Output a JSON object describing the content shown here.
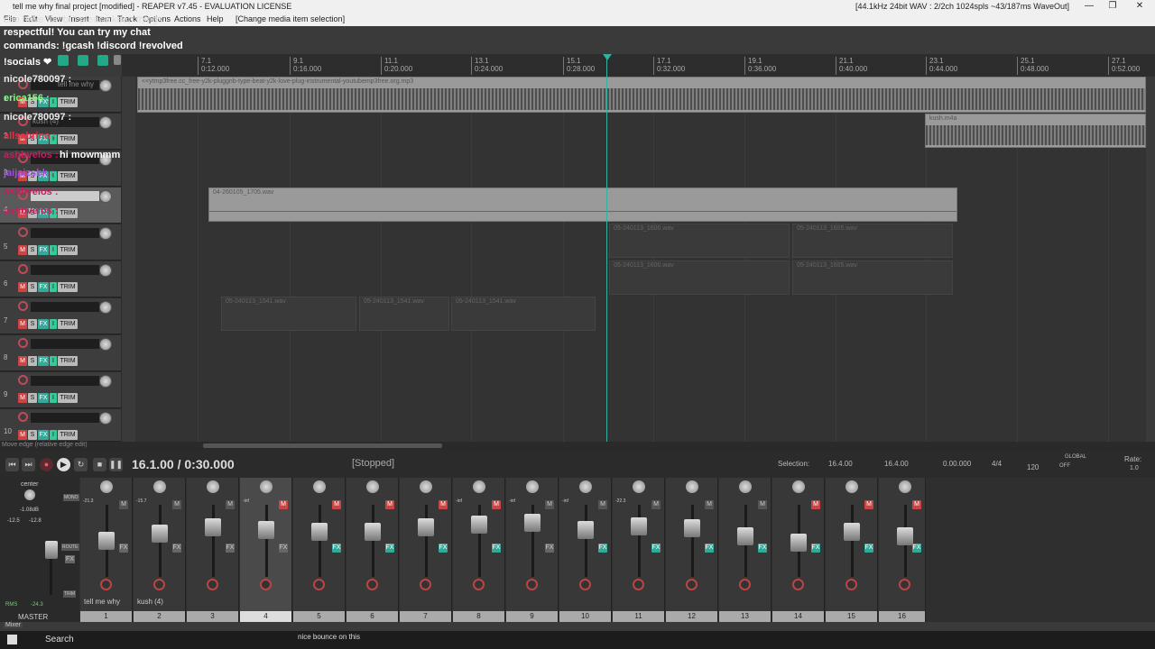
{
  "window": {
    "title": "tell me why final project [modified] - REAPER v7.45 - EVALUATION LICENSE",
    "audio_info": "[44.1kHz 24bit WAV : 2/2ch 1024spls ~43/187ms WaveOut]",
    "minimize": "—",
    "maximize": "❐",
    "close": "✕"
  },
  "menu": {
    "items": [
      "File",
      "Edit",
      "View",
      "Insert",
      "Item",
      "Track",
      "Options",
      "Actions",
      "Help"
    ],
    "change_media": "[Change media item selection]"
  },
  "chat_overlay": {
    "lines": [
      "can have fun but please keep things",
      "respectful! You can try my chat",
      "commands: !gcash !discord !revolved",
      "!socials ❤"
    ],
    "tcp_messages": [
      {
        "user": "nicole780097 :",
        "text": "",
        "color": "#e8e8e8"
      },
      {
        "user": "erica156 :",
        "text": "",
        "color": "#7cfc7c"
      },
      {
        "user": "nicole780097 :",
        "text": "",
        "color": "#e8e8e8"
      },
      {
        "user": "allsabrina :",
        "text": "",
        "color": "#e0304a"
      },
      {
        "user": "ashbvelos :",
        "text": "hi mowmmm",
        "color": "#c02060"
      },
      {
        "user": "jaijaizsbk :",
        "text": "",
        "color": "#a050e0"
      },
      {
        "user": "ashbvelos :",
        "text": "",
        "color": "#c02060"
      },
      {
        "user": "ashbvelos :",
        "text": "",
        "color": "#c02060"
      }
    ]
  },
  "ruler": {
    "ticks": [
      {
        "bar": "7.1",
        "time": "0:12.000"
      },
      {
        "bar": "9.1",
        "time": "0:16.000"
      },
      {
        "bar": "11.1",
        "time": "0:20.000"
      },
      {
        "bar": "13.1",
        "time": "0:24.000"
      },
      {
        "bar": "15.1",
        "time": "0:28.000"
      },
      {
        "bar": "17.1",
        "time": "0:32.000"
      },
      {
        "bar": "19.1",
        "time": "0:36.000"
      },
      {
        "bar": "21.1",
        "time": "0:40.000"
      },
      {
        "bar": "23.1",
        "time": "0:44.000"
      },
      {
        "bar": "25.1",
        "time": "0:48.000"
      },
      {
        "bar": "27.1",
        "time": "0:52.000"
      }
    ]
  },
  "tracks": [
    {
      "num": "1",
      "name": "tell me why"
    },
    {
      "num": "2",
      "name": "kush (4)"
    },
    {
      "num": "3",
      "name": ""
    },
    {
      "num": "4",
      "name": ""
    },
    {
      "num": "5",
      "name": ""
    },
    {
      "num": "6",
      "name": ""
    },
    {
      "num": "7",
      "name": ""
    },
    {
      "num": "8",
      "name": ""
    },
    {
      "num": "9",
      "name": ""
    },
    {
      "num": "10",
      "name": ""
    }
  ],
  "track_buttons": {
    "mute": "M",
    "solo": "S",
    "fx": "FX",
    "input": "I",
    "trim": "TRIM"
  },
  "items": {
    "beat": "<<ytmp3free.cc_free-y2k-pluggnb-type-beat-y2k-love-plug-instrumental-youtubemp3free.org.mp3",
    "kush": "kush.m4a",
    "vocal_long": "04-260105_1705.wav",
    "t5a": "05-240113_1600.wav",
    "t5b": "05-240113_1605.wav",
    "t6a": "05-240113_1600.wav",
    "t6b": "05-240113_1605.wav",
    "t7a": "05-240113_1541.wav",
    "t7b": "05-240113_1541.wav",
    "t7c": "05-240113_1541.wav"
  },
  "status_hint": "Move edge (relative edge edit)",
  "transport": {
    "position": "16.1.00 / 0:30.000",
    "state": "[Stopped]",
    "selection_label": "Selection:",
    "sel_start": "16.4.00",
    "sel_end": "16.4.00",
    "sel_len": "0.00.000",
    "time_sig": "4/4",
    "bpm": "120",
    "global": "GLOBAL",
    "global_state": "OFF",
    "rate_label": "Rate:",
    "rate": "1.0"
  },
  "mixer": {
    "master_label": "MASTER",
    "center_label": "center",
    "master_db": "-1.08dB",
    "master_left": "-12.5",
    "master_right": "-12.8",
    "rms_label": "RMS",
    "rms_value": "-24.3",
    "mono": "MONO",
    "route": "ROUTE",
    "fx": "FX",
    "trim": "TRIM",
    "mixer_tab": "Mixer",
    "strips": [
      {
        "num": "1",
        "name": "tell me why",
        "vol": "-21.3"
      },
      {
        "num": "2",
        "name": "kush (4)",
        "vol": "-15.7"
      },
      {
        "num": "3",
        "name": "",
        "vol": ""
      },
      {
        "num": "4",
        "name": "",
        "vol": "-inf"
      },
      {
        "num": "5",
        "name": "",
        "vol": ""
      },
      {
        "num": "6",
        "name": "",
        "vol": ""
      },
      {
        "num": "7",
        "name": "",
        "vol": ""
      },
      {
        "num": "8",
        "name": "",
        "vol": "-inf"
      },
      {
        "num": "9",
        "name": "",
        "vol": "-inf"
      },
      {
        "num": "10",
        "name": "",
        "vol": "-inf"
      },
      {
        "num": "11",
        "name": "",
        "vol": "-22.3"
      },
      {
        "num": "12",
        "name": "",
        "vol": ""
      },
      {
        "num": "13",
        "name": "",
        "vol": ""
      },
      {
        "num": "14",
        "name": "",
        "vol": ""
      },
      {
        "num": "15",
        "name": "",
        "vol": ""
      },
      {
        "num": "16",
        "name": "",
        "vol": ""
      }
    ]
  },
  "taskbar": {
    "search": "Search",
    "message": "nice bounce on this"
  }
}
